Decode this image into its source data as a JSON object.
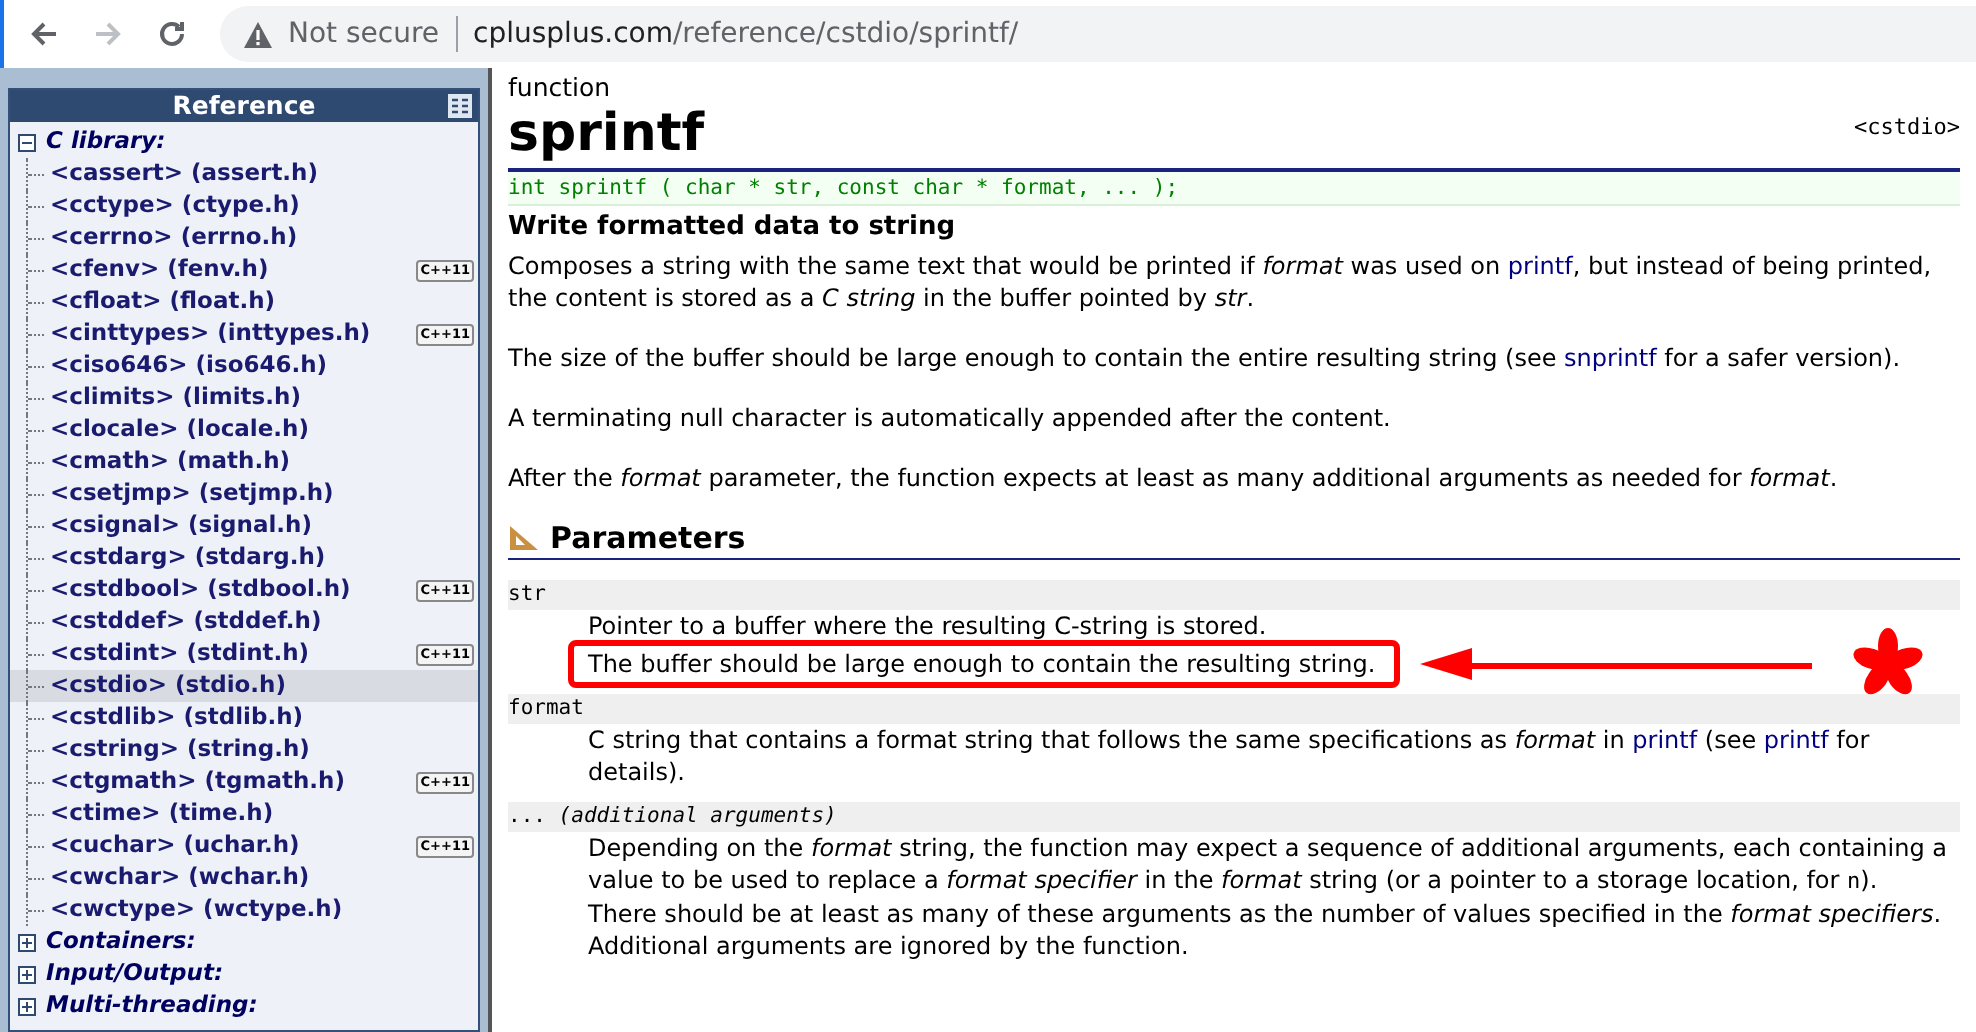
{
  "browser": {
    "security": "Not secure",
    "url_host": "cplusplus.com",
    "url_path": "/reference/cstdio/sprintf/"
  },
  "sidebar": {
    "title": "Reference",
    "groups": [
      {
        "label": "C library:",
        "expanded": true,
        "children": [
          {
            "label": "<cassert> (assert.h)",
            "selected": false
          },
          {
            "label": "<cctype> (ctype.h)",
            "selected": false
          },
          {
            "label": "<cerrno> (errno.h)",
            "selected": false
          },
          {
            "label": "<cfenv> (fenv.h)",
            "selected": false,
            "badge": "C++11"
          },
          {
            "label": "<cfloat> (float.h)",
            "selected": false
          },
          {
            "label": "<cinttypes> (inttypes.h)",
            "selected": false,
            "badge": "C++11"
          },
          {
            "label": "<ciso646> (iso646.h)",
            "selected": false
          },
          {
            "label": "<climits> (limits.h)",
            "selected": false
          },
          {
            "label": "<clocale> (locale.h)",
            "selected": false
          },
          {
            "label": "<cmath> (math.h)",
            "selected": false
          },
          {
            "label": "<csetjmp> (setjmp.h)",
            "selected": false
          },
          {
            "label": "<csignal> (signal.h)",
            "selected": false
          },
          {
            "label": "<cstdarg> (stdarg.h)",
            "selected": false
          },
          {
            "label": "<cstdbool> (stdbool.h)",
            "selected": false,
            "badge": "C++11"
          },
          {
            "label": "<cstddef> (stddef.h)",
            "selected": false
          },
          {
            "label": "<cstdint> (stdint.h)",
            "selected": false,
            "badge": "C++11"
          },
          {
            "label": "<cstdio> (stdio.h)",
            "selected": true
          },
          {
            "label": "<cstdlib> (stdlib.h)",
            "selected": false
          },
          {
            "label": "<cstring> (string.h)",
            "selected": false
          },
          {
            "label": "<ctgmath> (tgmath.h)",
            "selected": false,
            "badge": "C++11"
          },
          {
            "label": "<ctime> (time.h)",
            "selected": false
          },
          {
            "label": "<cuchar> (uchar.h)",
            "selected": false,
            "badge": "C++11"
          },
          {
            "label": "<cwchar> (wchar.h)",
            "selected": false
          },
          {
            "label": "<cwctype> (wctype.h)",
            "selected": false
          }
        ]
      },
      {
        "label": "Containers:",
        "expanded": false
      },
      {
        "label": "Input/Output:",
        "expanded": false
      },
      {
        "label": "Multi-threading:",
        "expanded": false
      }
    ]
  },
  "page": {
    "kind_label": "function",
    "title": "sprintf",
    "header": "<cstdio>",
    "prototype": "int sprintf ( char * str, const char * format, ... );",
    "summary": "Write formatted data to string",
    "paragraphs": [
      [
        {
          "text": "Composes a string with the same text that would be printed if ",
          "kind": "plain"
        },
        {
          "text": "format",
          "kind": "italic"
        },
        {
          "text": " was used on ",
          "kind": "plain"
        },
        {
          "text": "printf",
          "kind": "link"
        },
        {
          "text": ", but instead of being printed, the content is stored as a ",
          "kind": "plain"
        },
        {
          "text": "C string",
          "kind": "italic"
        },
        {
          "text": " in the buffer pointed by ",
          "kind": "plain"
        },
        {
          "text": "str",
          "kind": "italic"
        },
        {
          "text": ".",
          "kind": "plain"
        }
      ],
      [
        {
          "text": "The size of the buffer should be large enough to contain the entire resulting string (see ",
          "kind": "plain"
        },
        {
          "text": "snprintf",
          "kind": "link"
        },
        {
          "text": " for a safer version).",
          "kind": "plain"
        }
      ],
      [
        {
          "text": "A terminating null character is automatically appended after the content.",
          "kind": "plain"
        }
      ],
      [
        {
          "text": "After the ",
          "kind": "plain"
        },
        {
          "text": "format",
          "kind": "italic"
        },
        {
          "text": " parameter, the function expects at least as many additional arguments as needed for ",
          "kind": "plain"
        },
        {
          "text": "format",
          "kind": "italic"
        },
        {
          "text": ".",
          "kind": "plain"
        }
      ]
    ],
    "section": "Parameters",
    "parameters": [
      {
        "name": [
          {
            "text": "str",
            "kind": "plain"
          }
        ],
        "lines": [
          {
            "highlighted": false,
            "segments": [
              {
                "text": "Pointer to a buffer where the resulting C-string is stored.",
                "kind": "plain"
              }
            ]
          },
          {
            "highlighted": true,
            "segments": [
              {
                "text": "The buffer should be large enough to contain the resulting string.",
                "kind": "plain"
              }
            ]
          }
        ]
      },
      {
        "name": [
          {
            "text": "format",
            "kind": "plain"
          }
        ],
        "lines": [
          {
            "highlighted": false,
            "segments": [
              {
                "text": "C string that contains a format string that follows the same specifications as ",
                "kind": "plain"
              },
              {
                "text": "format",
                "kind": "italic"
              },
              {
                "text": " in ",
                "kind": "plain"
              },
              {
                "text": "printf",
                "kind": "link"
              },
              {
                "text": " (see ",
                "kind": "plain"
              },
              {
                "text": "printf",
                "kind": "link"
              },
              {
                "text": " for details).",
                "kind": "plain"
              }
            ]
          }
        ]
      },
      {
        "name": [
          {
            "text": "... ",
            "kind": "plain"
          },
          {
            "text": "(additional arguments)",
            "kind": "italic"
          }
        ],
        "lines": [
          {
            "highlighted": false,
            "segments": [
              {
                "text": "Depending on the ",
                "kind": "plain"
              },
              {
                "text": "format",
                "kind": "italic"
              },
              {
                "text": " string, the function may expect a sequence of additional arguments, each containing a value to be used to replace a ",
                "kind": "plain"
              },
              {
                "text": "format specifier",
                "kind": "italic"
              },
              {
                "text": " in the ",
                "kind": "plain"
              },
              {
                "text": "format",
                "kind": "italic"
              },
              {
                "text": " string (or a pointer to a storage location, for ",
                "kind": "plain"
              },
              {
                "text": "n",
                "kind": "code"
              },
              {
                "text": "). There should be at least as many of these arguments as the number of values specified in the ",
                "kind": "plain"
              },
              {
                "text": "format specifiers",
                "kind": "italic"
              },
              {
                "text": ". Additional arguments are ignored by the function.",
                "kind": "plain"
              }
            ]
          }
        ]
      }
    ]
  }
}
